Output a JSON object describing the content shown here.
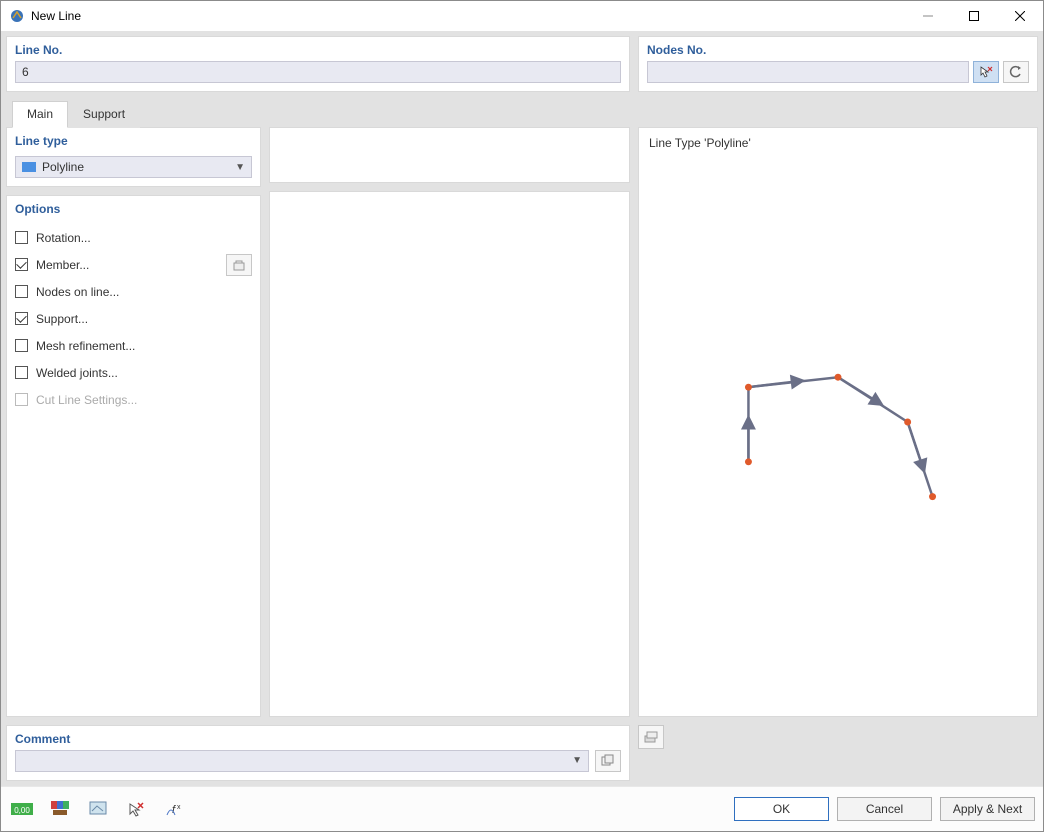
{
  "window": {
    "title": "New Line"
  },
  "lineNo": {
    "label": "Line No.",
    "value": "6"
  },
  "nodesNo": {
    "label": "Nodes No.",
    "value": ""
  },
  "tabs": {
    "main": "Main",
    "support": "Support"
  },
  "lineType": {
    "label": "Line type",
    "value": "Polyline"
  },
  "options": {
    "label": "Options",
    "items": [
      {
        "label": "Rotation...",
        "checked": false,
        "disabled": false
      },
      {
        "label": "Member...",
        "checked": true,
        "disabled": false,
        "hasBtn": true
      },
      {
        "label": "Nodes on line...",
        "checked": false,
        "disabled": false
      },
      {
        "label": "Support...",
        "checked": true,
        "disabled": false
      },
      {
        "label": "Mesh refinement...",
        "checked": false,
        "disabled": false
      },
      {
        "label": "Welded joints...",
        "checked": false,
        "disabled": false
      },
      {
        "label": "Cut Line Settings...",
        "checked": false,
        "disabled": true
      }
    ]
  },
  "preview": {
    "title": "Line Type 'Polyline'"
  },
  "comment": {
    "label": "Comment",
    "value": ""
  },
  "buttons": {
    "ok": "OK",
    "cancel": "Cancel",
    "applyNext": "Apply & Next"
  }
}
